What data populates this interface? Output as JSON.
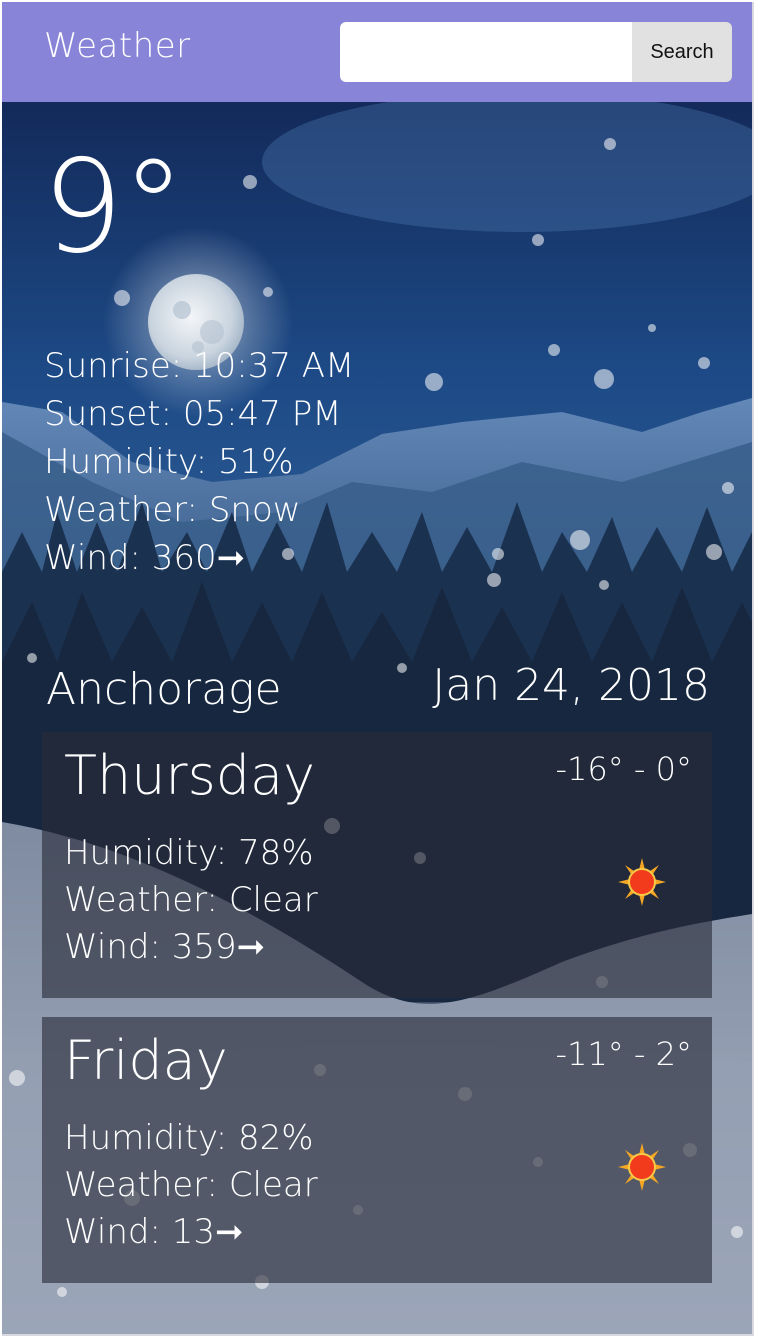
{
  "header": {
    "title": "Weather",
    "search_placeholder": "",
    "search_value": "",
    "search_button": "Search",
    "background_color": "#8884d8"
  },
  "current": {
    "temperature": "9°",
    "sunrise": "Sunrise: 10:37 AM",
    "sunset": "Sunset: 05:47 PM",
    "humidity": "Humidity: 51%",
    "weather": "Weather: Snow",
    "wind": "Wind: 360➞"
  },
  "location": {
    "city": "Anchorage",
    "date": "Jan 24, 2018"
  },
  "forecast": [
    {
      "day": "Thursday",
      "range": "-16° - 0°",
      "humidity": "Humidity: 78%",
      "weather": "Weather: Clear",
      "wind": "Wind: 359➞",
      "icon": "sun-icon"
    },
    {
      "day": "Friday",
      "range": "-11° - 2°",
      "humidity": "Humidity: 82%",
      "weather": "Weather: Clear",
      "wind": "Wind: 13➞",
      "icon": "sun-icon"
    }
  ]
}
